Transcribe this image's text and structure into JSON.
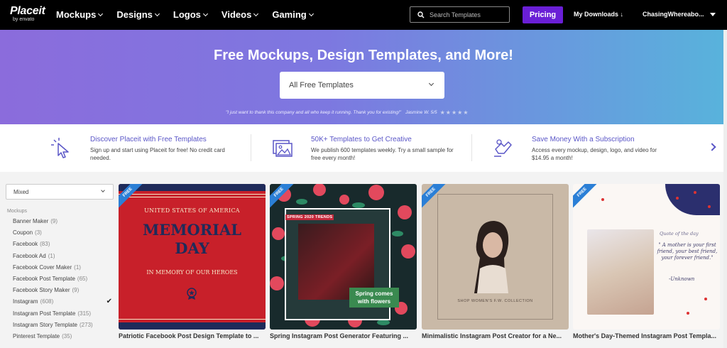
{
  "nav": {
    "logo": "Placeit",
    "logo_sub": "by envato",
    "menu": [
      "Mockups",
      "Designs",
      "Logos",
      "Videos",
      "Gaming"
    ],
    "search_placeholder": "Search Templates",
    "pricing_label": "Pricing",
    "downloads_label": "My Downloads",
    "user_label": "ChasingWhereabo..."
  },
  "hero": {
    "title": "Free Mockups, Design Templates, and More!",
    "select_value": "All Free Templates",
    "testimonial": "\"I just want to thank this company and all who keep it running. Thank you for existing!\"",
    "author": "Jasmine W. 5/5",
    "stars": "★★★★★",
    "background_gradient": [
      "#8b6cdc",
      "#58b3dc"
    ]
  },
  "features": [
    {
      "icon": "click-cursor-icon",
      "title": "Discover Placeit with Free Templates",
      "desc": "Sign up and start using Placeit for free! No credit card needed."
    },
    {
      "icon": "image-stack-icon",
      "title": "50K+ Templates to Get Creative",
      "desc": "We publish 600 templates weekly. Try a small sample for free every month!"
    },
    {
      "icon": "money-hand-icon",
      "title": "Save Money With a Subscription",
      "desc": "Access every mockup, design, logo, and video for $14.95 a month!"
    }
  ],
  "sidebar": {
    "sort_value": "Mixed",
    "section_label": "Mockups",
    "items": [
      {
        "label": "Banner Maker",
        "count": "(9)"
      },
      {
        "label": "Coupon",
        "count": "(3)"
      },
      {
        "label": "Facebook",
        "count": "(83)"
      },
      {
        "label": "Facebook Ad",
        "count": "(1)"
      },
      {
        "label": "Facebook Cover Maker",
        "count": "(1)"
      },
      {
        "label": "Facebook Post Template",
        "count": "(65)"
      },
      {
        "label": "Facebook Story Maker",
        "count": "(9)"
      },
      {
        "label": "Instagram",
        "count": "(608)",
        "checked": true
      },
      {
        "label": "Instagram Post Template",
        "count": "(315)"
      },
      {
        "label": "Instagram Story Template",
        "count": "(273)"
      },
      {
        "label": "Pinterest Template",
        "count": "(35)"
      }
    ]
  },
  "cards": [
    {
      "badge": "FREE",
      "title": "Patriotic Facebook Post Design Template to ...",
      "line1": "UNITED STATES OF AMERICA",
      "line2": "MEMORIAL",
      "line3": "DAY",
      "line4": "IN MEMORY OF OUR HEROES"
    },
    {
      "badge": "FREE",
      "title": "Spring Instagram Post Generator Featuring ...",
      "tag": "SPRING 2020 TRENDS",
      "overlay": "Spring comes with flowers"
    },
    {
      "badge": "FREE",
      "title": "Minimalistic Instagram Post Creator for a Ne...",
      "caption": "SHOP WOMEN'S F.W. COLLECTION"
    },
    {
      "badge": "FREE",
      "title": "Mother's Day-Themed Instagram Post Templa...",
      "quote_title": "Quote of the day",
      "quote": "\" A mother is your first friend, your best friend, your forever friend.\"",
      "signature": "-Unknown"
    }
  ],
  "colors": {
    "accent": "#6a1fd6",
    "feature_title": "#5a56c7",
    "ribbon": "#2b7fd6"
  }
}
